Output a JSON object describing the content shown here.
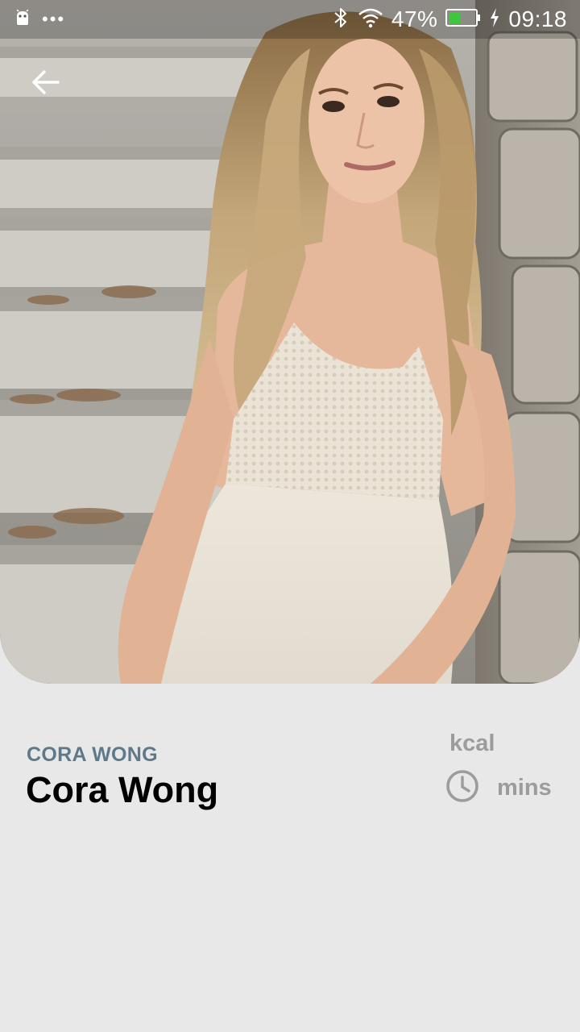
{
  "status_bar": {
    "notification_icons": [
      "android-icon",
      "more-dots-icon"
    ],
    "icons": [
      "bluetooth-icon",
      "wifi-icon",
      "battery-icon",
      "charging-icon"
    ],
    "battery_percent": "47%",
    "battery_level": 0.47,
    "time": "09:18"
  },
  "header": {
    "back_icon": "arrow-back-icon"
  },
  "hero": {
    "image": "portrait-photo"
  },
  "profile": {
    "category": "CORA WONG",
    "name": "Cora Wong"
  },
  "stats": {
    "calories_unit": "kcal",
    "time_icon": "clock-icon",
    "time_unit": "mins"
  },
  "colors": {
    "background": "#e8e8e8",
    "category_text": "#5e7a8a",
    "stat_text": "#9c9c9c",
    "battery_fill": "#3ec73e"
  }
}
